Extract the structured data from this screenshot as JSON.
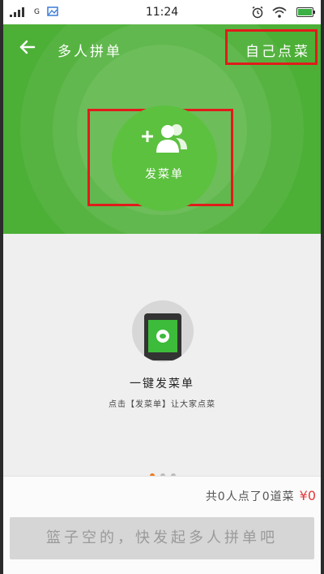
{
  "status_bar": {
    "network": "G",
    "time": "11:24",
    "icons": [
      "signal-icon",
      "image-icon",
      "alarm-icon",
      "wifi-icon",
      "battery-icon"
    ]
  },
  "header": {
    "title": "多人拼单",
    "self_order_label": "自己点菜",
    "send_label": "发菜单",
    "back_icon": "back-arrow-icon",
    "send_icon": "add-people-icon"
  },
  "intro": {
    "title": "一键发菜单",
    "subtitle": "点击【发菜单】让大家点菜",
    "illustration_icon": "wechat-phone-icon",
    "page_count": 3,
    "active_page": 1
  },
  "footer": {
    "summary": "共0人点了0道菜",
    "price": "¥0",
    "submit_label": "篮子空的，快发起多人拼单吧"
  },
  "colors": {
    "header_green": "#4caf36",
    "accent_red": "#e4393c",
    "dot_active": "#f07a20"
  }
}
